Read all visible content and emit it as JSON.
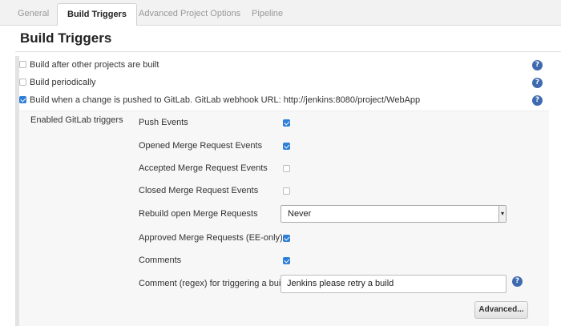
{
  "tabs": [
    {
      "label": "General",
      "active": false
    },
    {
      "label": "Build Triggers",
      "active": true
    },
    {
      "label": "Advanced Project Options",
      "active": false
    },
    {
      "label": "Pipeline",
      "active": false
    }
  ],
  "section": {
    "title": "Build Triggers"
  },
  "triggers": [
    {
      "label": "Build after other projects are built",
      "checked": false
    },
    {
      "label": "Build periodically",
      "checked": false
    },
    {
      "label": "Build when a change is pushed to GitLab. GitLab webhook URL: http://jenkins:8080/project/WebApp",
      "checked": true
    }
  ],
  "gitlab": {
    "group_label": "Enabled GitLab triggers",
    "options": [
      {
        "label": "Push Events",
        "checked": true
      },
      {
        "label": "Opened Merge Request Events",
        "checked": true
      },
      {
        "label": "Accepted Merge Request Events",
        "checked": false
      },
      {
        "label": "Closed Merge Request Events",
        "checked": false
      },
      {
        "label": "Approved Merge Requests (EE-only)",
        "checked": true
      },
      {
        "label": "Comments",
        "checked": true
      }
    ],
    "rebuild": {
      "label": "Rebuild open Merge Requests",
      "value": "Never"
    },
    "comment_regex": {
      "label": "Comment (regex) for triggering a build",
      "value": "Jenkins please retry a build"
    },
    "advanced_button": "Advanced..."
  },
  "icons": {
    "help": "question-mark-icon",
    "checkbox_color": "#2f7fd6"
  }
}
